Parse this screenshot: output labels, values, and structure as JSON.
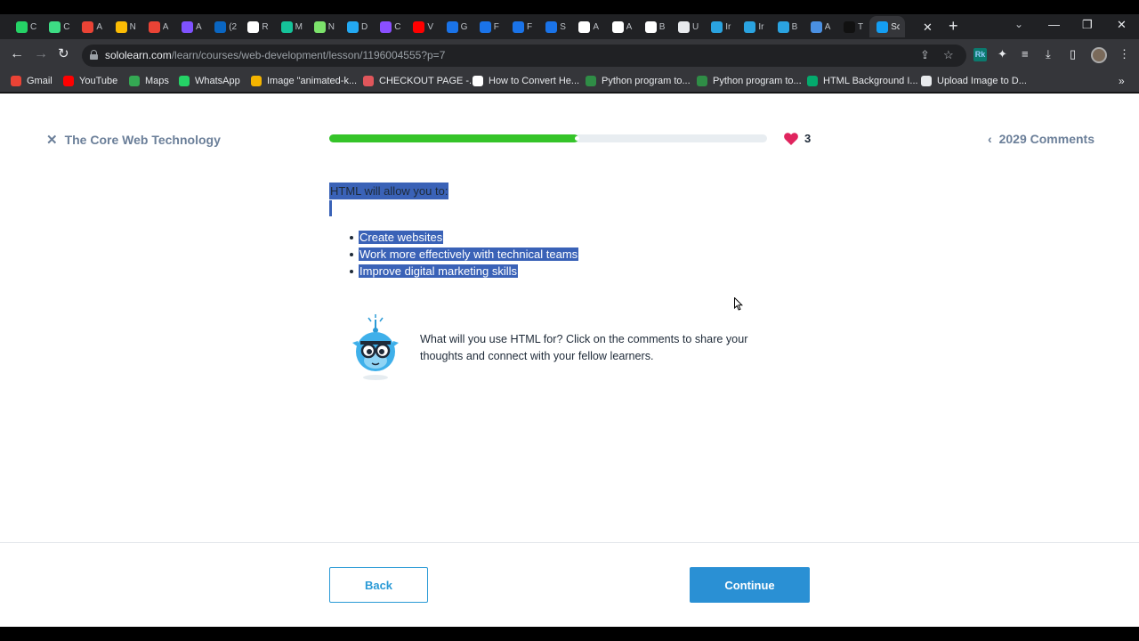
{
  "browser": {
    "tabs": [
      {
        "label": "C",
        "icon": "whatsapp-icon",
        "color": "#25d366"
      },
      {
        "label": "C",
        "icon": "android-icon",
        "color": "#3ddc84"
      },
      {
        "label": "A",
        "icon": "gmail-icon",
        "color": "#ea4335"
      },
      {
        "label": "N",
        "icon": "google-drive-icon",
        "color": "#fbbc04"
      },
      {
        "label": "A",
        "icon": "gmail-icon",
        "color": "#ea4335"
      },
      {
        "label": "A",
        "icon": "kotlin-icon",
        "color": "#7f52ff"
      },
      {
        "label": "(2",
        "icon": "linkedin-icon",
        "color": "#0a66c2"
      },
      {
        "label": "R",
        "icon": "notion-icon",
        "color": "#ffffff"
      },
      {
        "label": "M",
        "icon": "grammarly-icon",
        "color": "#15c39a"
      },
      {
        "label": "N",
        "icon": "link-icon",
        "color": "#7ce26b"
      },
      {
        "label": "D",
        "icon": "vscode-icon",
        "color": "#23a9f2"
      },
      {
        "label": "C",
        "icon": "extension-icon",
        "color": "#8a4fff"
      },
      {
        "label": "V",
        "icon": "youtube-icon",
        "color": "#ff0000"
      },
      {
        "label": "G",
        "icon": "c-icon",
        "color": "#1a73e8"
      },
      {
        "label": "F",
        "icon": "c-icon",
        "color": "#1a73e8"
      },
      {
        "label": "F",
        "icon": "c-icon",
        "color": "#1a73e8"
      },
      {
        "label": "S",
        "icon": "c-icon",
        "color": "#1a73e8"
      },
      {
        "label": "A",
        "icon": "amazon-icon",
        "color": "#ffffff"
      },
      {
        "label": "A",
        "icon": "amazon-icon",
        "color": "#ffffff"
      },
      {
        "label": "B",
        "icon": "amazon-icon",
        "color": "#ffffff"
      },
      {
        "label": "U",
        "icon": "globe-icon",
        "color": "#e8eaed"
      },
      {
        "label": "Ir",
        "icon": "ist-icon",
        "color": "#2aa3e0"
      },
      {
        "label": "Ir",
        "icon": "ist-icon",
        "color": "#2aa3e0"
      },
      {
        "label": "B",
        "icon": "bird-icon",
        "color": "#2aa3e0"
      },
      {
        "label": "A",
        "icon": "send-icon",
        "color": "#4a90e2"
      },
      {
        "label": "T",
        "icon": "terminal-icon",
        "color": "#111111"
      },
      {
        "label": "Sc",
        "icon": "sololearn-icon",
        "color": "#149ef2",
        "active": true
      }
    ],
    "new_tab": "+",
    "close_tab": "✕",
    "window_controls": {
      "minimize": "—",
      "restore": "❐",
      "close": "✕"
    },
    "url_host": "sololearn.com",
    "url_path": "/learn/courses/web-development/lesson/1196004555?p=7",
    "bookmarks": [
      {
        "label": "Gmail",
        "icon": "gmail-icon",
        "color": "#ea4335"
      },
      {
        "label": "YouTube",
        "icon": "youtube-icon",
        "color": "#ff0000"
      },
      {
        "label": "Maps",
        "icon": "maps-icon",
        "color": "#34a853"
      },
      {
        "label": "WhatsApp",
        "icon": "whatsapp-icon",
        "color": "#25d366"
      },
      {
        "label": "Image \"animated-k...",
        "icon": "star-icon",
        "color": "#f4b400"
      },
      {
        "label": "CHECKOUT PAGE -...",
        "icon": "lips-icon",
        "color": "#e0565b"
      },
      {
        "label": "How to Convert He...",
        "icon": "alpha-icon",
        "color": "#ffffff"
      },
      {
        "label": "Python program to...",
        "icon": "gfg-icon",
        "color": "#2f8d46"
      },
      {
        "label": "Python program to...",
        "icon": "gfg-icon",
        "color": "#2f8d46"
      },
      {
        "label": "HTML Background I...",
        "icon": "w3-icon",
        "color": "#04aa6d"
      },
      {
        "label": "Upload Image to D...",
        "icon": "globe-icon",
        "color": "#e8eaed"
      }
    ],
    "bookmarks_more": "»"
  },
  "lesson": {
    "course_title": "The Core Web Technology",
    "progress": 0.57,
    "hearts": "3",
    "comments_label": "2029 Comments",
    "intro": "HTML will allow you to:",
    "bullets": [
      "Create websites",
      "Work more effectively with technical teams",
      "Improve digital marketing skills"
    ],
    "tip": "What will you use HTML for? Click on the comments to share your thoughts and connect with your fellow learners.",
    "back_label": "Back",
    "continue_label": "Continue"
  },
  "colors": {
    "progress_fill": "#35c429",
    "heart": "#e0245e",
    "primary": "#2a90d4",
    "selection": "#3a62b7"
  }
}
